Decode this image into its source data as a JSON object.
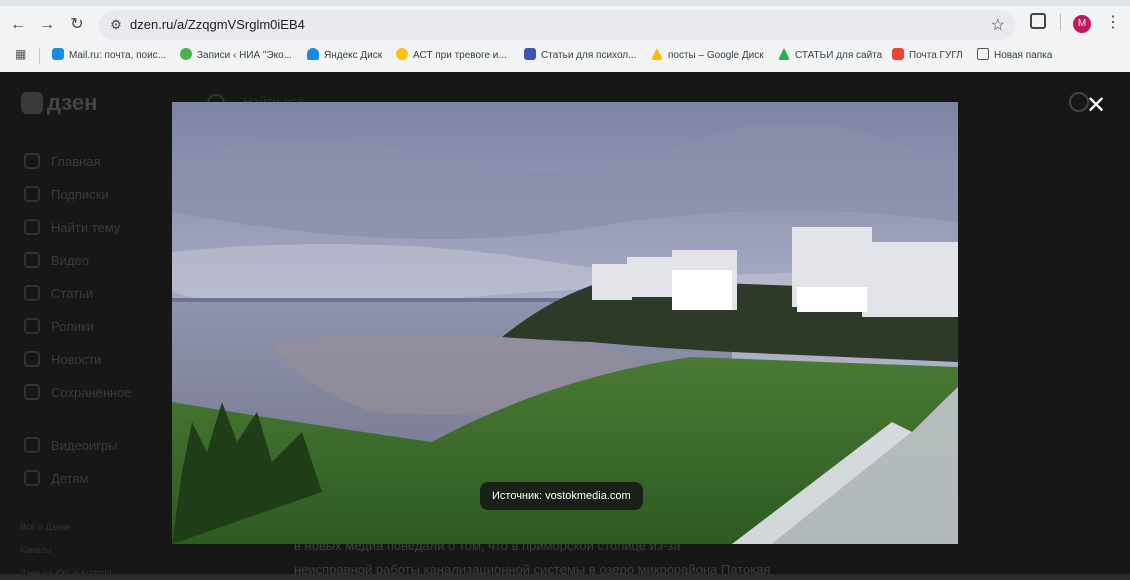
{
  "browser": {
    "url": "dzen.ru/a/ZzqgmVSrglm0iEB4",
    "profile_initial": "M",
    "bookmarks": [
      "Mail.ru: почта, поис...",
      "Записи ‹ НИА \"Эко...",
      "Яндекс Диск",
      "АСТ при тревоге и...",
      "Статьи для психол...",
      "посты – Google Диск",
      "СТАТЬИ для сайта",
      "Почта ГУГЛ",
      "Новая папка"
    ]
  },
  "page": {
    "logo_text": "дзен",
    "search_placeholder": "Найти всё",
    "sidebar": [
      "Главная",
      "Подписки",
      "Найти тему",
      "Видео",
      "Статьи",
      "Ролики",
      "Новости",
      "Сохранённое",
      "Видеоигры",
      "Детям"
    ],
    "sidebar_footer": [
      "Всё о Дзене",
      "Каналы",
      "Дзен на iOS и Android"
    ],
    "article_lines": [
      "в новых медиа поведали о том, что в приморской столице из-за",
      "неисправной работы канализационной системы в озеро микрорайона Патокая"
    ]
  },
  "viewer": {
    "caption": "Источник: vostokmedia.com"
  },
  "icons": {
    "back": "arrow-left-icon",
    "forward": "arrow-right-icon",
    "reload": "reload-icon",
    "site_settings": "tune-icon",
    "bookmark": "star-icon",
    "extensions": "puzzle-icon",
    "menu": "kebab-icon",
    "close": "close-icon"
  },
  "colors": {
    "avatar": "#c2185b",
    "overlay": "#171717"
  }
}
